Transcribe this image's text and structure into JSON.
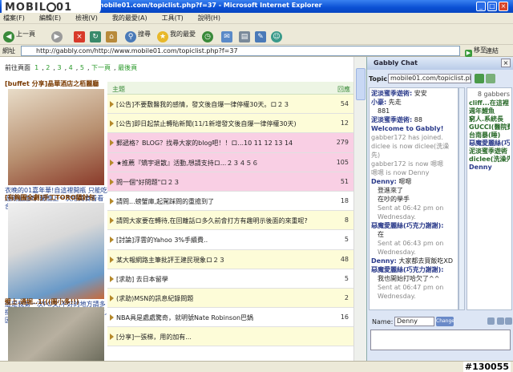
{
  "window": {
    "title": "...mobile01.com/topiclist.php?f=37 - Microsoft Internet Explorer",
    "logo": "MOBILE01"
  },
  "menu": [
    "檔案(F)",
    "編輯(E)",
    "檢視(V)",
    "我的最愛(A)",
    "工具(T)",
    "說明(H)"
  ],
  "toolbar": {
    "back": "上一頁",
    "search": "搜尋",
    "favorites": "我的最愛"
  },
  "address": {
    "label": "網址",
    "url": "http://gabbly.com/http://www.mobile01.com/topiclist.php?f=37",
    "go": "移至",
    "links": "連結"
  },
  "pager": {
    "label": "前往頁面",
    "pages": [
      "1",
      "2",
      "3",
      "4",
      "5"
    ],
    "next": "下一頁",
    "last": "最後頁"
  },
  "sidebar": [
    {
      "title": "[buffet 分享]晶華酒店之栢麗廳",
      "caption": "衣晚的01嘉年華!自這裡開瓶 只能吃過剛配過呀!蘭簡上一次用美食看看合位已經有一段時間了,在經..."
    },
    {
      "title": "[有夠圖全劇]手工TORO貓針包",
      "caption": "這是我第一次PO文,不好的地方請多指教唷 首先..我是男生..為了滿人數,因緣際會參加..."
    },
    {
      "title": "壁上.通堀..1(((圖小多!!)",
      "caption": ""
    }
  ],
  "topics": {
    "head_topic": "主題",
    "head_replies": "回應",
    "rows": [
      {
        "title": "[公告]不要敷醫我的感情，發文後自爆一律停權30天。ロ２３",
        "replies": "54",
        "style": "y"
      },
      {
        "title": "[公告]即日起禁止轉貼新聞(11/1新增發文後自爆一律停權30天)",
        "replies": "12",
        "style": "y"
      },
      {
        "title": "郵遞格？BLOG？找尋大家的blog吧！！ロ...10 11 12 13 14",
        "replies": "279",
        "style": "p"
      },
      {
        "title": "★推薦『矯宇退散』活動,想請支持ロ...２３４５６",
        "replies": "105",
        "style": "p"
      },
      {
        "title": "問一個\"好問題\"ロ２３",
        "replies": "51",
        "style": "p"
      },
      {
        "title": "請問...螃蟹庫,起駕踩問的重擔到了",
        "replies": "18",
        "style": "w"
      },
      {
        "title": "請問大家要在轉待,在回離話ロ多久前會打方有趣明示後面的來重呢?",
        "replies": "8",
        "style": "w"
      },
      {
        "title": "[討論]浮雲的Yahoo 3%手續費..",
        "replies": "5",
        "style": "w"
      },
      {
        "title": "某大報網路主筆批評王建民現象ロ２３",
        "replies": "48",
        "style": "w"
      },
      {
        "title": "[求助] 去日本留學",
        "replies": "5",
        "style": "w"
      },
      {
        "title": "(求助)MSN的訊息紀錄問題",
        "replies": "2",
        "style": "w"
      },
      {
        "title": "NBA具是處處驚奇，就明號Nate Robinson巴鍋",
        "replies": "16",
        "style": "w"
      },
      {
        "title": "[分享]一張梯，用的加有...",
        "replies": "",
        "style": "w"
      }
    ]
  },
  "chat": {
    "title": "Gabbly Chat",
    "topic_label": "Topic:",
    "topic_value": "mobile01.com/topiclist.php?",
    "user_count": "8 gabbers",
    "messages": [
      {
        "who": "泥淡蜜季遊術:",
        "text": "安安",
        "cls": "nm"
      },
      {
        "who": "小豪:",
        "text": "先走",
        "cls": "nm"
      },
      {
        "who": "",
        "text": "881",
        "cls": "ind"
      },
      {
        "who": "泥淡蜜季遊術:",
        "text": "88",
        "cls": "nm"
      },
      {
        "who": "Welcome to",
        "text": "Gabbly!",
        "cls": "sys"
      },
      {
        "who": "",
        "text": "gabber172 has joined.",
        "cls": "sys"
      },
      {
        "who": "",
        "text": "diclee is now diclee(洗澡",
        "cls": "sys"
      },
      {
        "who": "",
        "text": "先)",
        "cls": "sys"
      },
      {
        "who": "",
        "text": "gabber172 is now 嗯嗯",
        "cls": "sys"
      },
      {
        "who": "",
        "text": "嗯嗯 is now Denny",
        "cls": "sys"
      },
      {
        "who": "Denny:",
        "text": "嗯嗯",
        "cls": "nm"
      },
      {
        "who": "",
        "text": "登進來了",
        "cls": "ind"
      },
      {
        "who": "",
        "text": "在吵的學手",
        "cls": "ind"
      },
      {
        "who": "",
        "text": "Sent at 06:42 pm on",
        "cls": "sys"
      },
      {
        "who": "",
        "text": "Wednesday.",
        "cls": "sys"
      },
      {
        "who": "惡魔愛麗絲(巧克力謝謝):",
        "text": "",
        "cls": "nm"
      },
      {
        "who": "",
        "text": "在",
        "cls": "ind"
      },
      {
        "who": "",
        "text": "Sent at 06:43 pm on",
        "cls": "sys"
      },
      {
        "who": "",
        "text": "Wednesday.",
        "cls": "sys"
      },
      {
        "who": "Denny:",
        "text": "大家都去買飯吃XD",
        "cls": "nm"
      },
      {
        "who": "惡魔愛麗絲(巧克力謝謝):",
        "text": "",
        "cls": "nm"
      },
      {
        "who": "",
        "text": "我也開始打哈欠了^^",
        "cls": "ind"
      },
      {
        "who": "",
        "text": "Sent at 06:47 pm on",
        "cls": "sys"
      },
      {
        "who": "",
        "text": "Wednesday.",
        "cls": "sys"
      }
    ],
    "users": [
      "cliff...在這裡",
      "週年鯉魚",
      "窮人.系統長",
      "GUCCI(醫院費水教)",
      "台南暴(睡)",
      "惡魔愛麗絲(巧克力謝謝)",
      "泥淡蜜季遊術",
      "diclee(洗澡先)",
      "Denny"
    ],
    "name_label": "Name:",
    "name_value": "Denny",
    "change": "Change"
  },
  "status": {
    "watermark": "#130055"
  }
}
